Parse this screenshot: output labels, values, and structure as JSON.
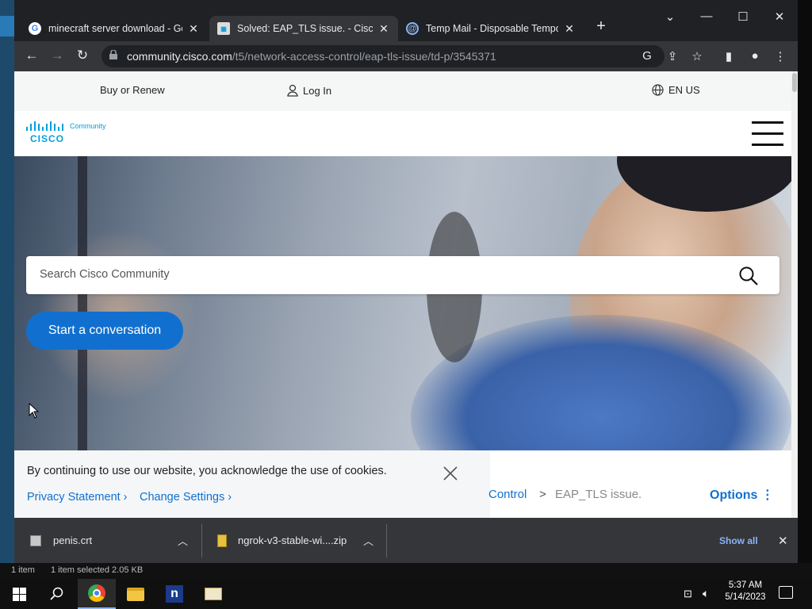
{
  "browser": {
    "tabs": [
      {
        "title": "minecraft server download - Goo",
        "icon": "google-icon",
        "active": false
      },
      {
        "title": "Solved: EAP_TLS issue. - Cisco Co",
        "icon": "cisco-favicon",
        "active": true
      },
      {
        "title": "Temp Mail - Disposable Tempora",
        "icon": "tempmail-icon",
        "active": false
      }
    ],
    "new_tab": "+",
    "url_host": "community.cisco.com",
    "url_path": "/t5/network-access-control/eap-tls-issue/td-p/3545371"
  },
  "site": {
    "util_buy": "Buy or Renew",
    "util_login": "Log In",
    "util_lang": "EN US",
    "logo_word": "CISCO",
    "logo_sub": "Community",
    "search_placeholder": "Search Cisco Community",
    "start_button": "Start a conversation",
    "cookie_message": "By continuing to use our website, you acknowledge the use of cookies.",
    "privacy_link": "Privacy Statement ›",
    "settings_link": "Change Settings ›",
    "crumb_prev": "Control",
    "crumb_sep": ">",
    "crumb_current": "EAP_TLS issue.",
    "options_label": "Options"
  },
  "downloads": {
    "items": [
      {
        "name": "penis.crt",
        "icon": "certificate-file-icon"
      },
      {
        "name": "ngrok-v3-stable-wi....zip",
        "icon": "zip-file-icon"
      }
    ],
    "show_all": "Show all"
  },
  "explorer_status": {
    "items": "1 item",
    "selected": "1 item selected  2.05 KB"
  },
  "taskbar": {
    "time": "5:37 AM",
    "date": "5/14/2023"
  },
  "colors": {
    "cisco_blue": "#1170cf",
    "cisco_logo": "#049fd9",
    "chrome_dark": "#202124",
    "chrome_mid": "#35363a"
  }
}
